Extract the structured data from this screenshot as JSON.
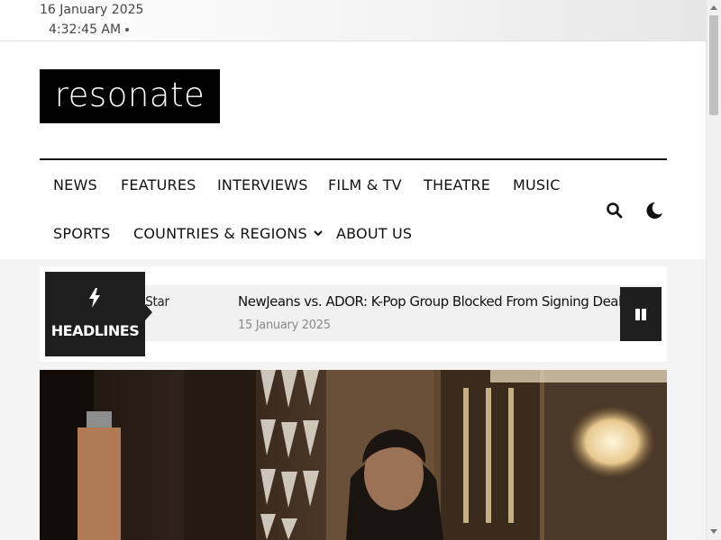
{
  "topbar": {
    "date": "16 January 2025",
    "time": "4:32:45 AM"
  },
  "brand": {
    "logo_text": "resonate"
  },
  "nav": {
    "row1": [
      "NEWS",
      "FEATURES",
      "INTERVIEWS",
      "FILM & TV",
      "THEATRE",
      "MUSIC"
    ],
    "row2": [
      "SPORTS",
      "COUNTRIES & REGIONS",
      "ABOUT US"
    ]
  },
  "icons": {
    "search": "search-icon",
    "theme": "moon-icon",
    "headlines": "bolt-icon",
    "pause": "pause-icon",
    "dropdown": "chevron-down-icon"
  },
  "ticker": {
    "label": "HEADLINES",
    "previous_title_fragment": "Global Star",
    "current_title": "NewJeans vs. ADOR: K-Pop Group Blocked From Signing Deals Amid C",
    "current_date": "15 January 2025"
  },
  "colors": {
    "accent_dark": "#1e1e1e",
    "logo_bg": "#000000",
    "page_bg": "#f4f4f4"
  }
}
